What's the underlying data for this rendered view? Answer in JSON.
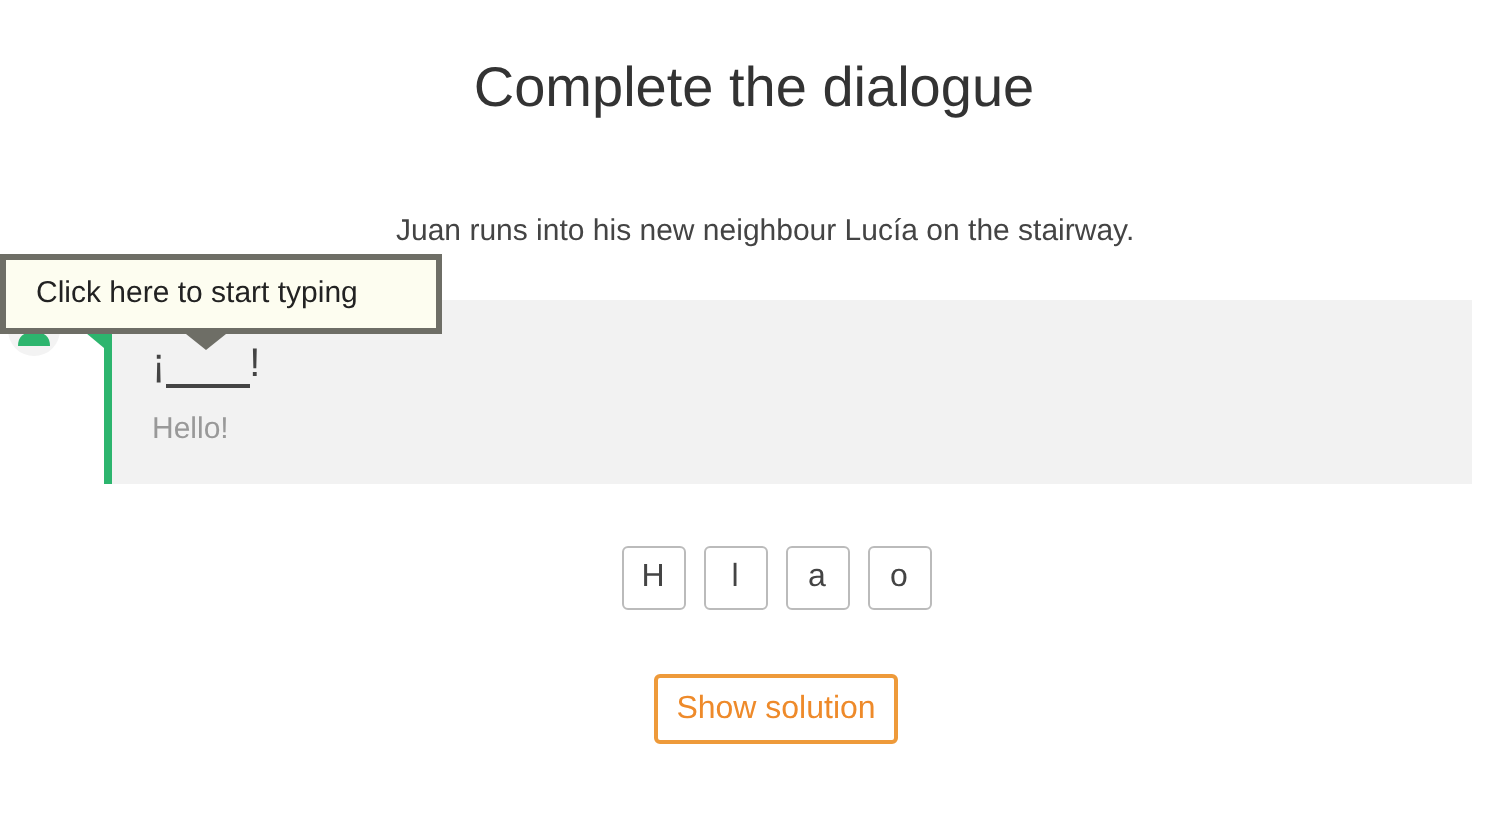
{
  "title": "Complete the dialogue",
  "intro": "Juan runs into his new neighbour Lucía on the stairway.",
  "tooltip": "Click here to start typing",
  "line": {
    "prefix": "¡",
    "suffix": "!",
    "translation": "Hello!"
  },
  "letters": [
    "H",
    "l",
    "a",
    "o"
  ],
  "solution_button": "Show solution"
}
